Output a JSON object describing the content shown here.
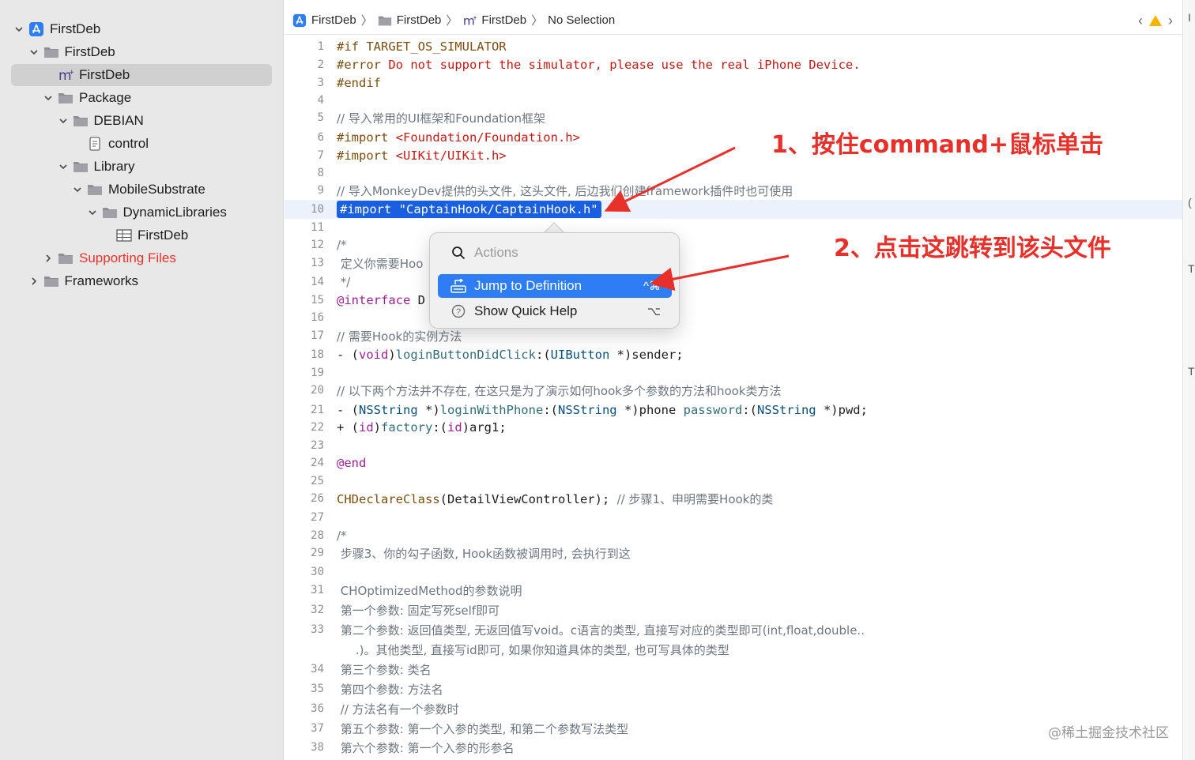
{
  "sidebar": {
    "items": [
      {
        "label": "FirstDeb",
        "icon": "app-project-icon",
        "expanded": true,
        "indent": 0
      },
      {
        "label": "FirstDeb",
        "icon": "folder-icon",
        "expanded": true,
        "indent": 1
      },
      {
        "label": "FirstDeb",
        "icon": "objc-source-icon",
        "selected": true,
        "indent": 2
      },
      {
        "label": "Package",
        "icon": "folder-icon",
        "expanded": true,
        "indent": 2
      },
      {
        "label": "DEBIAN",
        "icon": "folder-icon",
        "expanded": true,
        "indent": 3
      },
      {
        "label": "control",
        "icon": "document-icon",
        "indent": 4
      },
      {
        "label": "Library",
        "icon": "folder-icon",
        "expanded": true,
        "indent": 3
      },
      {
        "label": "MobileSubstrate",
        "icon": "folder-icon",
        "expanded": true,
        "indent": 4
      },
      {
        "label": "DynamicLibraries",
        "icon": "folder-icon",
        "expanded": true,
        "indent": 5
      },
      {
        "label": "FirstDeb",
        "icon": "plist-table-icon",
        "indent": 6
      },
      {
        "label": "Supporting Files",
        "icon": "folder-icon",
        "expanded": false,
        "indent": 2,
        "red": true
      },
      {
        "label": "Frameworks",
        "icon": "folder-icon",
        "expanded": false,
        "indent": 1
      }
    ]
  },
  "jumpbar": {
    "crumbs": [
      {
        "label": "FirstDeb",
        "icon": "app-project-icon"
      },
      {
        "label": "FirstDeb",
        "icon": "folder-icon"
      },
      {
        "label": "FirstDeb",
        "icon": "objc-source-icon"
      },
      {
        "label": "No Selection",
        "icon": ""
      }
    ]
  },
  "editor": {
    "current_line": 10,
    "lines": [
      {
        "n": "1",
        "segs": [
          [
            "pre",
            "#if TARGET_OS_SIMULATOR"
          ]
        ]
      },
      {
        "n": "2",
        "segs": [
          [
            "pre",
            "#error "
          ],
          [
            "str",
            "Do not support the simulator, please use the real iPhone Device."
          ]
        ]
      },
      {
        "n": "3",
        "segs": [
          [
            "pre",
            "#endif"
          ]
        ]
      },
      {
        "n": "4",
        "segs": []
      },
      {
        "n": "5",
        "segs": [
          [
            "com",
            "// 导入常用的UI框架和Foundation框架"
          ]
        ]
      },
      {
        "n": "6",
        "segs": [
          [
            "pre",
            "#import "
          ],
          [
            "str",
            "<Foundation/Foundation.h>"
          ]
        ]
      },
      {
        "n": "7",
        "segs": [
          [
            "pre",
            "#import "
          ],
          [
            "str",
            "<UIKit/UIKit.h>"
          ]
        ]
      },
      {
        "n": "8",
        "segs": []
      },
      {
        "n": "9",
        "segs": [
          [
            "com",
            "// 导入MonkeyDev提供的头文件, 这头文件, 后边我们创建framework插件时也可使用"
          ]
        ]
      },
      {
        "n": "10",
        "segs": [
          [
            "sel",
            "#import \"CaptainHook/CaptainHook.h\""
          ]
        ]
      },
      {
        "n": "11",
        "segs": []
      },
      {
        "n": "12",
        "segs": [
          [
            "com",
            "/*"
          ]
        ]
      },
      {
        "n": "13",
        "segs": [
          [
            "com",
            " 定义你需要Hoo"
          ]
        ]
      },
      {
        "n": "14",
        "segs": [
          [
            "com",
            " */"
          ]
        ]
      },
      {
        "n": "15",
        "segs": [
          [
            "kw",
            "@interface"
          ],
          [
            "",
            " D"
          ]
        ]
      },
      {
        "n": "16",
        "segs": []
      },
      {
        "n": "17",
        "segs": [
          [
            "com",
            "// 需要Hook的实例方法"
          ]
        ]
      },
      {
        "n": "18",
        "segs": [
          [
            "",
            "- ("
          ],
          [
            "kw",
            "void"
          ],
          [
            "",
            ")"
          ],
          [
            "fn",
            "loginButtonDidClick"
          ],
          [
            "",
            ":("
          ],
          [
            "ty",
            "UIButton"
          ],
          [
            "",
            " *)sender;"
          ]
        ]
      },
      {
        "n": "19",
        "segs": []
      },
      {
        "n": "20",
        "segs": [
          [
            "com",
            "// 以下两个方法并不存在, 在这只是为了演示如何hook多个参数的方法和hook类方法"
          ]
        ]
      },
      {
        "n": "21",
        "segs": [
          [
            "",
            "- ("
          ],
          [
            "ty",
            "NSString"
          ],
          [
            "",
            " *)"
          ],
          [
            "fn",
            "loginWithPhone"
          ],
          [
            "",
            ":("
          ],
          [
            "ty",
            "NSString"
          ],
          [
            "",
            " *)phone "
          ],
          [
            "fn",
            "password"
          ],
          [
            "",
            ":("
          ],
          [
            "ty",
            "NSString"
          ],
          [
            "",
            " *)pwd;"
          ]
        ]
      },
      {
        "n": "22",
        "segs": [
          [
            "",
            "+ ("
          ],
          [
            "kw",
            "id"
          ],
          [
            "",
            ")"
          ],
          [
            "fn",
            "factory"
          ],
          [
            "",
            ":("
          ],
          [
            "kw",
            "id"
          ],
          [
            "",
            ")arg1;"
          ]
        ]
      },
      {
        "n": "23",
        "segs": []
      },
      {
        "n": "24",
        "segs": [
          [
            "kw",
            "@end"
          ]
        ]
      },
      {
        "n": "25",
        "segs": []
      },
      {
        "n": "26",
        "segs": [
          [
            "pre",
            "CHDeclareClass"
          ],
          [
            "",
            "(DetailViewController); "
          ],
          [
            "com",
            "// 步骤1、申明需要Hook的类"
          ]
        ]
      },
      {
        "n": "27",
        "segs": []
      },
      {
        "n": "28",
        "segs": [
          [
            "com",
            "/*"
          ]
        ]
      },
      {
        "n": "29",
        "segs": [
          [
            "com",
            " 步骤3、你的勾子函数, Hook函数被调用时, 会执行到这"
          ]
        ]
      },
      {
        "n": "30",
        "segs": []
      },
      {
        "n": "31",
        "segs": [
          [
            "com",
            " CHOptimizedMethod的参数说明"
          ]
        ]
      },
      {
        "n": "32",
        "segs": [
          [
            "com",
            " 第一个参数: 固定写死self即可"
          ]
        ]
      },
      {
        "n": "33",
        "segs": [
          [
            "com",
            " 第二个参数: 返回值类型, 无返回值写void。c语言的类型, 直接写对应的类型即可(int,float,double.."
          ]
        ]
      },
      {
        "n": "",
        "segs": [
          [
            "com",
            "     .)。其他类型, 直接写id即可, 如果你知道具体的类型, 也可写具体的类型"
          ]
        ]
      },
      {
        "n": "34",
        "segs": [
          [
            "com",
            " 第三个参数: 类名"
          ]
        ]
      },
      {
        "n": "35",
        "segs": [
          [
            "com",
            " 第四个参数: 方法名"
          ]
        ]
      },
      {
        "n": "36",
        "segs": [
          [
            "com",
            " // 方法名有一个参数时"
          ]
        ]
      },
      {
        "n": "37",
        "segs": [
          [
            "com",
            " 第五个参数: 第一个入参的类型, 和第二个参数写法类型"
          ]
        ]
      },
      {
        "n": "38",
        "segs": [
          [
            "com",
            " 第六个参数: 第一个入参的形参名"
          ]
        ]
      }
    ]
  },
  "popup": {
    "search_placeholder": "Actions",
    "jump_label": "Jump to Definition",
    "jump_shortcut": "^⌘",
    "help_label": "Show Quick Help",
    "help_shortcut": "⌥"
  },
  "annotations": {
    "step1": "1、按住command+鼠标单击",
    "step2": "2、点击这跳转到该头文件"
  },
  "watermark": "@稀土掘金技术社区",
  "colors": {
    "annotation_red": "#e8302a",
    "selection_blue": "#1a5fe0",
    "menu_highlight": "#2f7df5",
    "warning_yellow": "#f5b400"
  }
}
